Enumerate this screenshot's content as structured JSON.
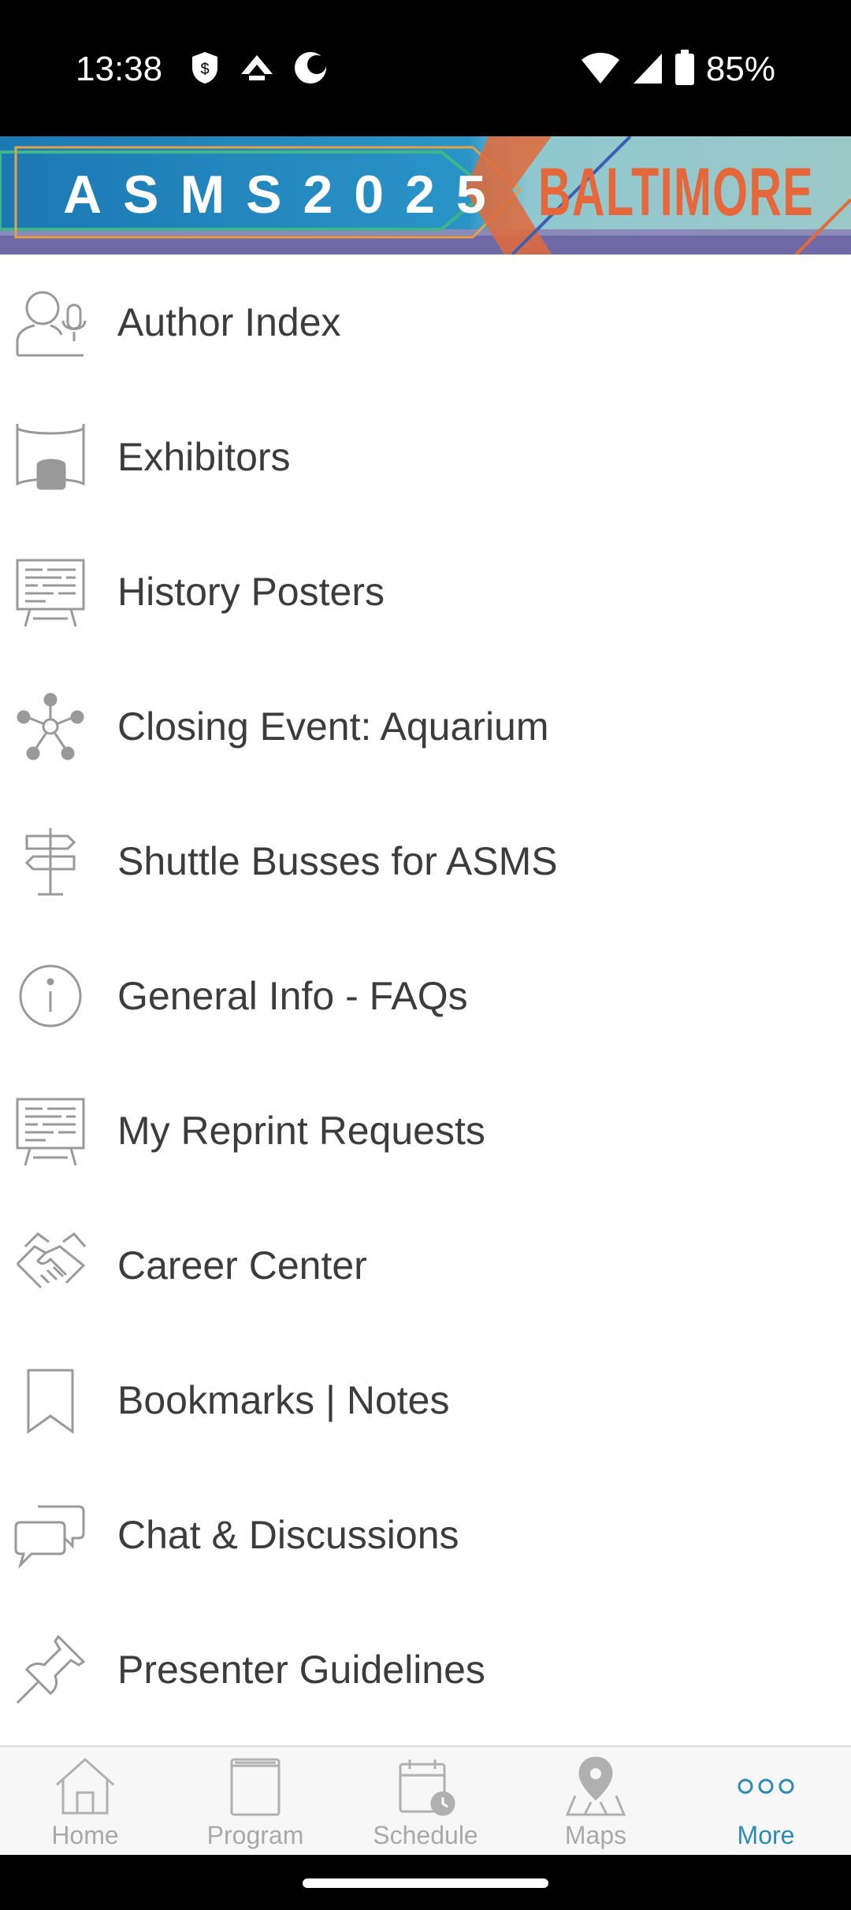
{
  "status_bar": {
    "time": "13:38",
    "battery": "85%",
    "left_icons": [
      "shield-icon",
      "arrow-up-icon",
      "moon-icon"
    ],
    "right_icons": [
      "wifi-icon",
      "cell-signal-icon",
      "battery-icon"
    ]
  },
  "banner": {
    "event": "ASMS2025",
    "city": "BALTIMORE",
    "colors": {
      "blue": "#1d7fb5",
      "orange": "#e9633a",
      "purple": "#6f6aa6"
    }
  },
  "menu": {
    "items": [
      {
        "label": "Author Index",
        "icon": "author-mic-icon"
      },
      {
        "label": "Exhibitors",
        "icon": "exhibitor-booth-icon"
      },
      {
        "label": "History Posters",
        "icon": "easel-icon"
      },
      {
        "label": "Closing Event: Aquarium",
        "icon": "network-icon"
      },
      {
        "label": "Shuttle Busses for ASMS",
        "icon": "signpost-icon"
      },
      {
        "label": "General Info - FAQs",
        "icon": "info-icon"
      },
      {
        "label": "My Reprint Requests",
        "icon": "easel-icon"
      },
      {
        "label": "Career Center",
        "icon": "handshake-icon"
      },
      {
        "label": "Bookmarks | Notes",
        "icon": "bookmark-icon"
      },
      {
        "label": "Chat & Discussions",
        "icon": "chat-bubbles-icon"
      },
      {
        "label": "Presenter Guidelines",
        "icon": "pushpin-icon"
      }
    ]
  },
  "bottom_nav": {
    "items": [
      {
        "label": "Home",
        "icon": "home-icon",
        "active": false
      },
      {
        "label": "Program",
        "icon": "book-icon",
        "active": false
      },
      {
        "label": "Schedule",
        "icon": "calendar-clock-icon",
        "active": false
      },
      {
        "label": "Maps",
        "icon": "map-pin-icon",
        "active": false
      },
      {
        "label": "More",
        "icon": "more-dots-icon",
        "active": true
      }
    ],
    "active_color": "#2b8bb3",
    "inactive_color": "#a9a9a9"
  }
}
